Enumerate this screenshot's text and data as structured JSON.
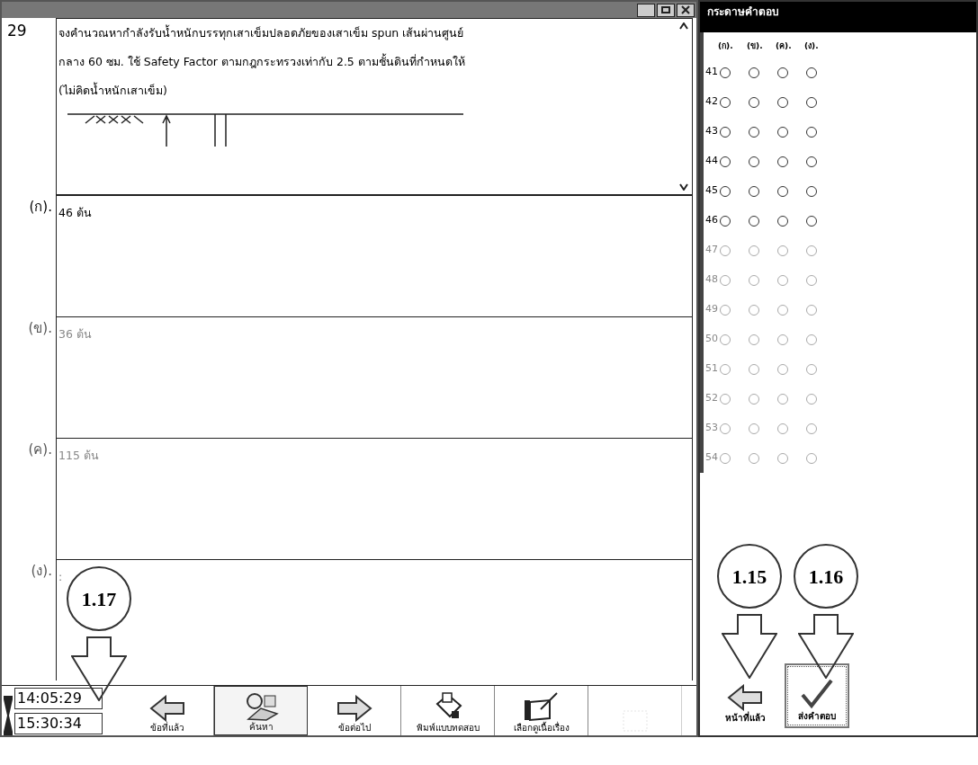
{
  "question": {
    "number": "29",
    "lines": [
      "จงคำนวณหากำลังรับน้ำหนักบรรทุกเสาเข็มปลอดภัยของเสาเข็ม spun เส้นผ่านศูนย์",
      "กลาง 60 ซม. ใช้ Safety Factor ตามกฎกระทรวงเท่ากับ 2.5 ตามชั้นดินที่กำหนดให้",
      "(ไม่คิดน้ำหนักเสาเข็ม)"
    ]
  },
  "choices": [
    {
      "label": "(ก).",
      "text": "46 ต้น",
      "dim": false
    },
    {
      "label": "(ข).",
      "text": "36 ต้น",
      "dim": true
    },
    {
      "label": "(ค).",
      "text": "115 ต้น",
      "dim": true
    },
    {
      "label": "(ง).",
      "text": ":",
      "dim": true
    }
  ],
  "timers": [
    "14:05:29",
    "15:30:34"
  ],
  "toolbar": [
    {
      "kind": "back",
      "label": "ข้อที่แล้ว",
      "pressed": false,
      "disabled": false
    },
    {
      "kind": "search",
      "label": "ค้นหา",
      "pressed": true,
      "disabled": false
    },
    {
      "kind": "next",
      "label": "ข้อต่อไป",
      "pressed": false,
      "disabled": false
    },
    {
      "kind": "print",
      "label": "พิมพ์แบบทดสอบ",
      "pressed": false,
      "disabled": false
    },
    {
      "kind": "story",
      "label": "เลือกดูเนื้อเรื่อง",
      "pressed": false,
      "disabled": false
    },
    {
      "kind": "blank",
      "pressed": false,
      "disabled": true
    }
  ],
  "answer_sheet": {
    "title": "กระดาษคำตอบ",
    "columns": [
      "(ก).",
      "(ข).",
      "(ค).",
      "(ง)."
    ],
    "rows": [
      {
        "number": "41",
        "disabled": false,
        "answer": null
      },
      {
        "number": "42",
        "disabled": false,
        "answer": null
      },
      {
        "number": "43",
        "disabled": false,
        "answer": null
      },
      {
        "number": "44",
        "disabled": false,
        "answer": null
      },
      {
        "number": "45",
        "disabled": false,
        "answer": null
      },
      {
        "number": "46",
        "disabled": false,
        "answer": null
      },
      {
        "number": "47",
        "disabled": true,
        "answer": null
      },
      {
        "number": "48",
        "disabled": true,
        "answer": null
      },
      {
        "number": "49",
        "disabled": true,
        "answer": null
      },
      {
        "number": "50",
        "disabled": true,
        "answer": null
      },
      {
        "number": "51",
        "disabled": true,
        "answer": null
      },
      {
        "number": "52",
        "disabled": true,
        "answer": null
      },
      {
        "number": "53",
        "disabled": true,
        "answer": null
      },
      {
        "number": "54",
        "disabled": true,
        "answer": null
      }
    ],
    "buttons": [
      {
        "kind": "previous-page",
        "label": "หน้าที่แล้ว"
      },
      {
        "kind": "submit",
        "label": "ส่งคำตอบ"
      }
    ]
  },
  "callouts": [
    "1.15",
    "1.16",
    "1.17"
  ]
}
